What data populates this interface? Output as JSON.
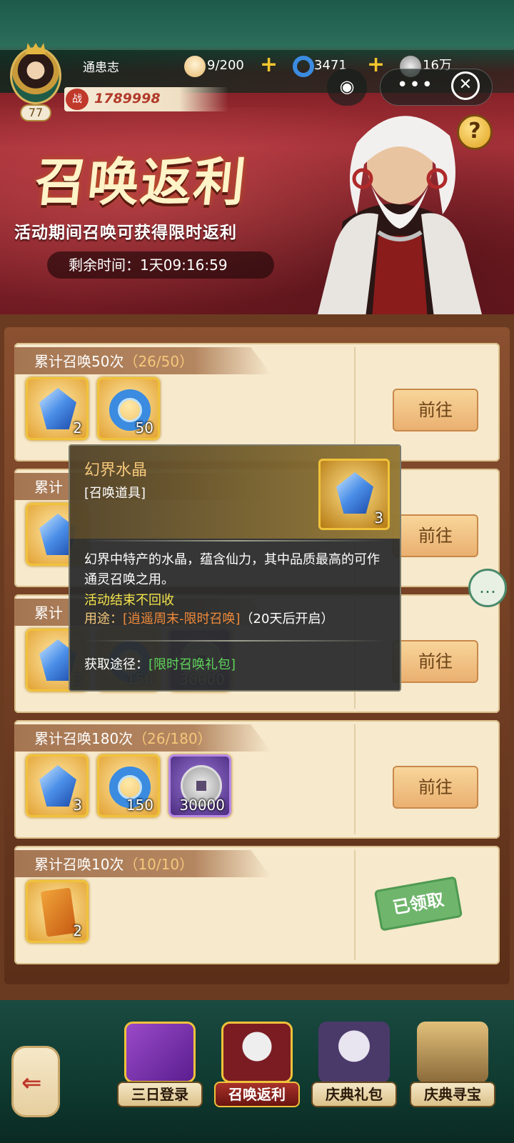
{
  "player": {
    "name": "通患志",
    "level": "77",
    "power_badge": "战",
    "power": "1789998"
  },
  "resources": [
    {
      "name": "stamina",
      "icon": "bun-icon",
      "value": "9/200"
    },
    {
      "name": "jade",
      "icon": "jade-ring-icon",
      "value": "3471"
    },
    {
      "name": "coins",
      "icon": "coin-icon",
      "value": "16万"
    }
  ],
  "event": {
    "title": "召唤返利",
    "subtitle": "活动期间召唤可获得限时返利",
    "timer_label": "剩余时间：",
    "timer_value": "1天09:16:59"
  },
  "tasks": [
    {
      "title": "累计召唤50次",
      "progress": "（26/50）",
      "rewards": [
        {
          "icon": "crystal-icon",
          "count": "2"
        },
        {
          "icon": "jade-ring-icon",
          "count": "50"
        }
      ],
      "action": "前往"
    },
    {
      "title": "累计",
      "progress": "",
      "rewards": [
        {
          "icon": "crystal-icon",
          "count": ""
        }
      ],
      "action": "前往"
    },
    {
      "title": "累计",
      "progress": "",
      "rewards": [
        {
          "icon": "crystal-icon",
          "count": "3"
        },
        {
          "icon": "jade-ring-icon",
          "count": "150"
        },
        {
          "icon": "coin-icon",
          "count": "30000"
        }
      ],
      "action": "前往"
    },
    {
      "title": "累计召唤180次",
      "progress": "（26/180）",
      "rewards": [
        {
          "icon": "crystal-icon",
          "count": "3"
        },
        {
          "icon": "jade-ring-icon",
          "count": "150"
        },
        {
          "icon": "coin-icon",
          "count": "30000"
        }
      ],
      "action": "前往"
    },
    {
      "title": "累计召唤10次",
      "progress": "（10/10）",
      "rewards": [
        {
          "icon": "scroll-icon",
          "count": "2"
        }
      ],
      "action": "已领取"
    }
  ],
  "tooltip": {
    "name": "幻界水晶",
    "type": "[召唤道具]",
    "count": "3",
    "description": "幻界中特产的水晶，蕴含仙力，其中品质最高的可作通灵召唤之用。",
    "note": "活动结束不回收",
    "use_label": "用途：",
    "use_value": "[逍遥周末-限时召唤]",
    "use_suffix": "（20天后开启）",
    "source_label": "获取途径：",
    "source_value": "[限时召唤礼包]"
  },
  "nav": {
    "tabs": [
      {
        "label": "三日登录",
        "icon": "gift-box-icon"
      },
      {
        "label": "召唤返利",
        "icon": "elder-portrait-icon",
        "active": true
      },
      {
        "label": "庆典礼包",
        "icon": "fox-maiden-icon"
      },
      {
        "label": "庆典寻宝",
        "icon": "treasure-icon"
      }
    ]
  },
  "colors": {
    "accent": "#f5c77a",
    "header_red": "#a8323a",
    "claimed_green": "#6fb56c"
  }
}
